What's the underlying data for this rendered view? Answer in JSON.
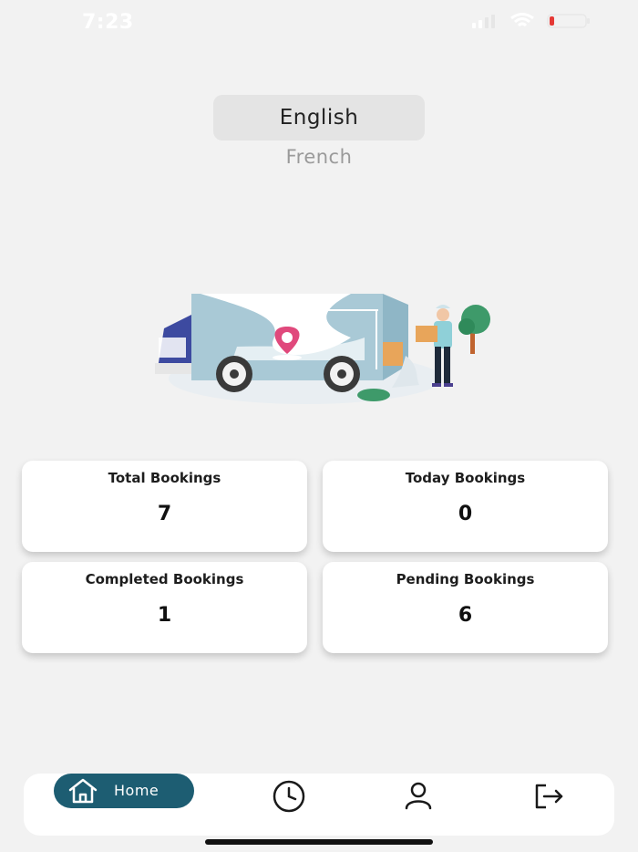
{
  "status": {
    "time": "7:23"
  },
  "language": {
    "selected": "English",
    "other": "French"
  },
  "stats": [
    {
      "label": "Total Bookings",
      "value": "7"
    },
    {
      "label": "Today Bookings",
      "value": "0"
    },
    {
      "label": "Completed Bookings",
      "value": "1"
    },
    {
      "label": "Pending Bookings",
      "value": "6"
    }
  ],
  "nav": {
    "home_label": "Home",
    "items": [
      {
        "icon": "home-icon"
      },
      {
        "icon": "history-clock-icon"
      },
      {
        "icon": "profile-icon"
      },
      {
        "icon": "logout-icon"
      }
    ]
  },
  "colors": {
    "accent": "#1d5d72",
    "background": "#f2f2f2",
    "card": "#ffffff"
  }
}
